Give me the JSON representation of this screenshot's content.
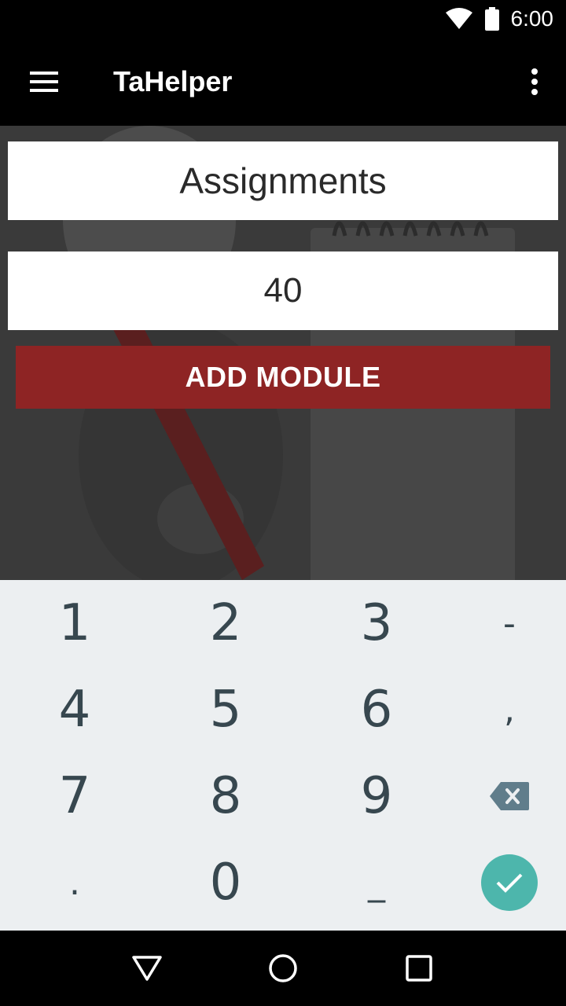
{
  "status": {
    "time": "6:00",
    "icons": [
      "wifi-icon",
      "battery-icon"
    ]
  },
  "appbar": {
    "title": "TaHelper",
    "menu_icon": "hamburger-menu-icon",
    "overflow_icon": "more-vert-icon"
  },
  "form": {
    "module_name": "Assignments",
    "module_value": "40",
    "add_button_label": "ADD MODULE"
  },
  "keypad": {
    "row1": [
      "1",
      "2",
      "3",
      "-"
    ],
    "row2": [
      "4",
      "5",
      "6",
      ","
    ],
    "row3": [
      "7",
      "8",
      "9"
    ],
    "row4": [
      ".",
      "0",
      "_"
    ],
    "backspace_icon": "backspace-icon",
    "done_icon": "check-icon"
  },
  "colors": {
    "accent": "#8e2424",
    "done": "#4db6ac",
    "keypad_bg": "#eceff1",
    "key_text": "#37474f"
  },
  "navbar": {
    "icons": [
      "back-icon",
      "home-icon",
      "recents-icon"
    ]
  }
}
